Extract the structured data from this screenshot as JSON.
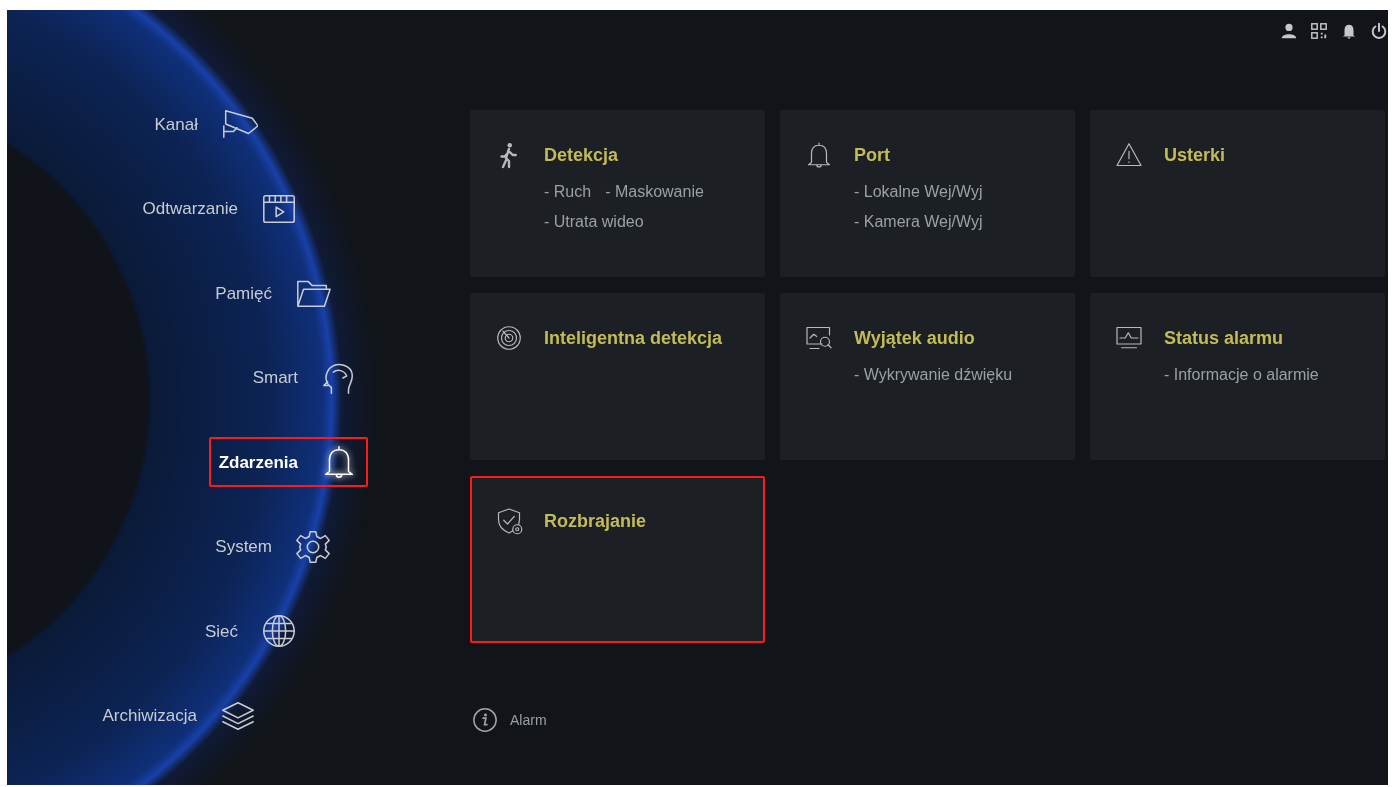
{
  "header_icons": [
    {
      "kind": "user"
    },
    {
      "kind": "qr"
    },
    {
      "kind": "bell"
    },
    {
      "kind": "power"
    }
  ],
  "sidebar": {
    "items": [
      {
        "label": "Kanał",
        "kind": "camera",
        "selected": false,
        "highlighted": false
      },
      {
        "label": "Odtwarzanie",
        "kind": "playback",
        "selected": false,
        "highlighted": false
      },
      {
        "label": "Pamięć",
        "kind": "folder",
        "selected": false,
        "highlighted": false
      },
      {
        "label": "Smart",
        "kind": "head",
        "selected": false,
        "highlighted": false
      },
      {
        "label": "Zdarzenia",
        "kind": "bell",
        "selected": true,
        "highlighted": true
      },
      {
        "label": "System",
        "kind": "gear",
        "selected": false,
        "highlighted": false
      },
      {
        "label": "Sieć",
        "kind": "globe",
        "selected": false,
        "highlighted": false
      },
      {
        "label": "Archiwizacja",
        "kind": "layers",
        "selected": false,
        "highlighted": false
      }
    ]
  },
  "cards": [
    {
      "title": "Detekcja",
      "kind": "walker",
      "highlighted": false,
      "lines": [
        [
          "- Ruch",
          "- Maskowanie"
        ],
        [
          "- Utrata wideo"
        ]
      ]
    },
    {
      "title": "Port",
      "kind": "bell",
      "highlighted": false,
      "lines": [
        [
          "- Lokalne Wej/Wyj"
        ],
        [
          "- Kamera Wej/Wyj"
        ]
      ]
    },
    {
      "title": "Usterki",
      "kind": "warning",
      "highlighted": false
    },
    {
      "title": "Inteligentna detekcja",
      "kind": "target",
      "highlighted": false
    },
    {
      "title": "Wyjątek audio",
      "kind": "monitor-search",
      "highlighted": false,
      "lines": [
        [
          "- Wykrywanie dźwięku"
        ]
      ]
    },
    {
      "title": "Status alarmu",
      "kind": "monitor-wave",
      "highlighted": false,
      "lines": [
        [
          "- Informacje o alarmie"
        ]
      ]
    },
    {
      "title": "Rozbrajanie",
      "kind": "shield",
      "highlighted": true
    }
  ],
  "footer": {
    "text": "Alarm"
  }
}
